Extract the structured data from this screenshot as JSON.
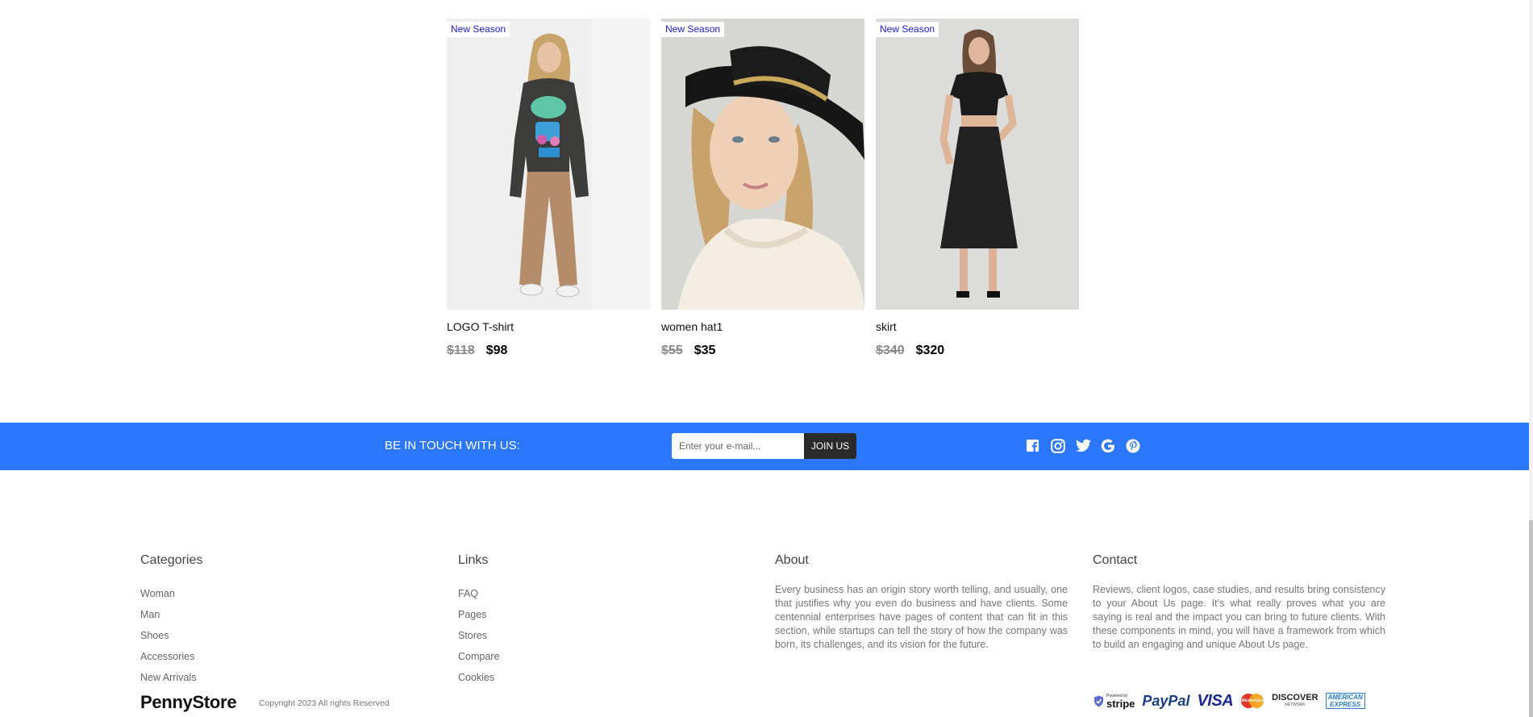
{
  "products": [
    {
      "badge": "New Season",
      "name": "LOGO T-shirt",
      "old_price": "$118",
      "price": "$98"
    },
    {
      "badge": "New Season",
      "name": "women hat1",
      "old_price": "$55",
      "price": "$35"
    },
    {
      "badge": "New Season",
      "name": "skirt",
      "old_price": "$340",
      "price": "$320"
    }
  ],
  "newsletter": {
    "title": "BE IN TOUCH WITH US:",
    "placeholder": "Enter your e-mail...",
    "button": "JOIN US",
    "social_icons": [
      "facebook-icon",
      "instagram-icon",
      "twitter-icon",
      "google-icon",
      "pinterest-icon"
    ]
  },
  "footer": {
    "categories": {
      "title": "Categories",
      "items": [
        "Woman",
        "Man",
        "Shoes",
        "Accessories",
        "New Arrivals"
      ]
    },
    "links": {
      "title": "Links",
      "items": [
        "FAQ",
        "Pages",
        "Stores",
        "Compare",
        "Cookies"
      ]
    },
    "about": {
      "title": "About",
      "text": "Every business has an origin story worth telling, and usually, one that justifies why you even do business and have clients. Some centennial enterprises have pages of content that can fit in this section, while startups can tell the story of how the company was born, its challenges, and its vision for the future."
    },
    "contact": {
      "title": "Contact",
      "text": "Reviews, client logos, case studies, and results bring consistency to your About Us page. It’s what really proves what you are saying is real and the impact you can bring to future clients. With these components in mind, you will have a framework from which to build an engaging and unique About Us page."
    },
    "brand": "PennyStore",
    "copyright": "Copyright 2023 All rights Reserved",
    "payments": {
      "stripe_prefix": "Powered by",
      "stripe": "stripe",
      "paypal": "PayPal",
      "visa": "VISA",
      "mastercard": "MasterCard",
      "discover": "DISCOVER",
      "discover_sub": "NETWORK",
      "amex_top": "AMERICAN",
      "amex_bottom": "EXPRESS"
    }
  },
  "colors": {
    "accent_bar": "#2b78ff",
    "badge_text": "#1a1adf",
    "join_button": "#2a2a2a"
  }
}
